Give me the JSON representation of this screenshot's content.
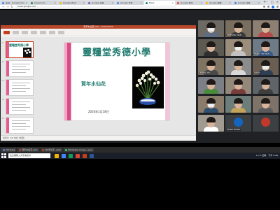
{
  "browser": {
    "tabs": [
      {
        "title": "主頁 - Google Drive",
        "color": "#4285f4",
        "active": false
      },
      {
        "title": "Classroom",
        "color": "#1e8e3e",
        "active": false
      },
      {
        "title": "Google Meet",
        "color": "#fbbc04",
        "active": false
      },
      {
        "title": "Google 表單",
        "color": "#7e57c2",
        "active": false
      },
      {
        "title": "Google 文件",
        "color": "#4285f4",
        "active": false
      },
      {
        "title": "Meet",
        "color": "#00897b",
        "active": true
      },
      {
        "title": "Google 搜尋",
        "color": "#ea4335",
        "active": false
      },
      {
        "title": "Google 相簿",
        "color": "#fbbc04",
        "active": false
      },
      {
        "title": "Google 日曆",
        "color": "#4285f4",
        "active": false
      }
    ],
    "url": "meet.google.com"
  },
  "powerpoint": {
    "window_title": "賀年水仙花.pptx - PowerPoint",
    "status": "投影片 1/5  中文 (香港)"
  },
  "slide": {
    "title": "靈糧堂秀德小學",
    "subtitle": "賀年水仙花",
    "date": "2020年1月18日"
  },
  "thumbnails": [
    {
      "num": "1",
      "title": "靈糧堂秀德小學",
      "selected": true
    },
    {
      "num": "2",
      "title": "",
      "selected": false
    },
    {
      "num": "3",
      "title": "",
      "selected": false
    },
    {
      "num": "4",
      "title": "",
      "selected": false
    },
    {
      "num": "5",
      "title": "",
      "selected": false
    }
  ],
  "participants": [
    {
      "name": "",
      "bg": "#6d6a63",
      "shirt": "#5b6c83"
    },
    {
      "name": "CHEUNG MAN",
      "bg": "#7a6e5e",
      "shirt": "#3a3a3a"
    },
    {
      "name": "",
      "bg": "#8d8072",
      "shirt": "#b24a4a"
    },
    {
      "name": "",
      "bg": "#5d5a52",
      "shirt": "#2f2f2f"
    },
    {
      "name": "",
      "bg": "#9b8d7c",
      "shirt": "#c2c2c2"
    },
    {
      "name": "TANG YIM MAN",
      "bg": "#6e7b86",
      "shirt": "#365a8a"
    },
    {
      "name": "WONG HO",
      "bg": "#7f7362",
      "shirt": "#4a4a4a"
    },
    {
      "name": "",
      "bg": "#8c8c8c",
      "shirt": "#d9d9d9"
    },
    {
      "name": "CHAN",
      "bg": "#6a5e52",
      "shirt": "#2d3e55"
    },
    {
      "name": "",
      "bg": "#7c7f86",
      "shirt": "#4a8a3a"
    },
    {
      "name": "",
      "bg": "#93887a",
      "shirt": "#7a3b3b"
    },
    {
      "name": "",
      "bg": "#5f6468",
      "shirt": "#3f3f3f"
    },
    {
      "name": "",
      "bg": "#8a7b6b",
      "shirt": "#2f4f6f"
    },
    {
      "name": "",
      "bg": "#6d7e7a",
      "shirt": "#c4a35a"
    },
    {
      "name": "",
      "bg": "#7d7368",
      "shirt": "#5a5a5a"
    },
    {
      "name": "",
      "bg": "#a09a90",
      "shirt": "#ffffff"
    },
    {
      "name": "CHAN WOOK",
      "bg": "#3c4043",
      "avatar": "#1565c0"
    },
    {
      "name": "",
      "bg": "#3c4043",
      "avatar": "#c0392b"
    }
  ],
  "meeting": {
    "info": "下午5:26  |  靈糧堂秀德小學水仙花",
    "right_controls": [
      "ⓘ",
      "👥 13",
      "💬",
      "⚙"
    ]
  },
  "bottom_tabs": [
    {
      "label": "2018.jpg",
      "color": "#4285f4"
    },
    {
      "label": "賀年水仙花.pptx",
      "color": "#c43e1c"
    },
    {
      "label": "202年1月...pptx",
      "color": "#c43e1c"
    },
    {
      "label": "Whatsapp Image...jpeg",
      "color": "#25d366"
    }
  ],
  "taskbar": {
    "search_placeholder": "在這裡輸入文字來搜尋",
    "apps": [
      "#f4b400",
      "#4285f4",
      "#0f9d58",
      "#db4437",
      "#c43e1c",
      "#2b579a"
    ],
    "tray_text": "17°C 天晴",
    "time": "下午 5:26"
  }
}
